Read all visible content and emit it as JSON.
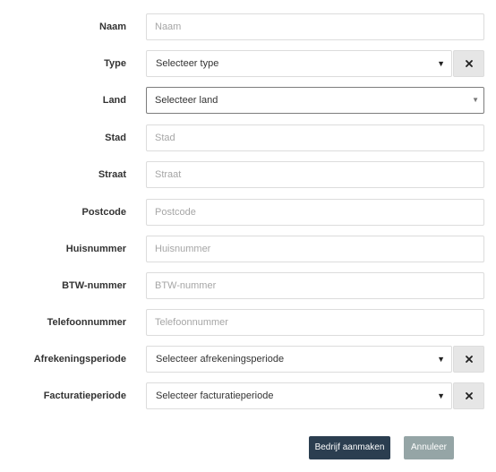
{
  "form": {
    "naam": {
      "label": "Naam",
      "placeholder": "Naam"
    },
    "type": {
      "label": "Type",
      "selected": "Selecteer type"
    },
    "land": {
      "label": "Land",
      "selected": "Selecteer land"
    },
    "stad": {
      "label": "Stad",
      "placeholder": "Stad"
    },
    "straat": {
      "label": "Straat",
      "placeholder": "Straat"
    },
    "postcode": {
      "label": "Postcode",
      "placeholder": "Postcode"
    },
    "huisnummer": {
      "label": "Huisnummer",
      "placeholder": "Huisnummer"
    },
    "btw": {
      "label": "BTW-nummer",
      "placeholder": "BTW-nummer"
    },
    "telefoon": {
      "label": "Telefoonnummer",
      "placeholder": "Telefoonnummer"
    },
    "afrekening": {
      "label": "Afrekeningsperiode",
      "selected": "Selecteer afrekeningsperiode"
    },
    "facturatie": {
      "label": "Facturatieperiode",
      "selected": "Selecteer facturatieperiode"
    }
  },
  "icons": {
    "caret": "caret-down-icon",
    "clear": "close-icon"
  },
  "colors": {
    "primary_button": "#2b3e50",
    "cancel_button": "#95a5a6",
    "clear_button_bg": "#e6e6e6",
    "input_border": "#dcdcdc",
    "placeholder": "#a6a6a6"
  },
  "actions": {
    "submit_label": "Bedrijf aanmaken",
    "cancel_label": "Annuleer"
  }
}
